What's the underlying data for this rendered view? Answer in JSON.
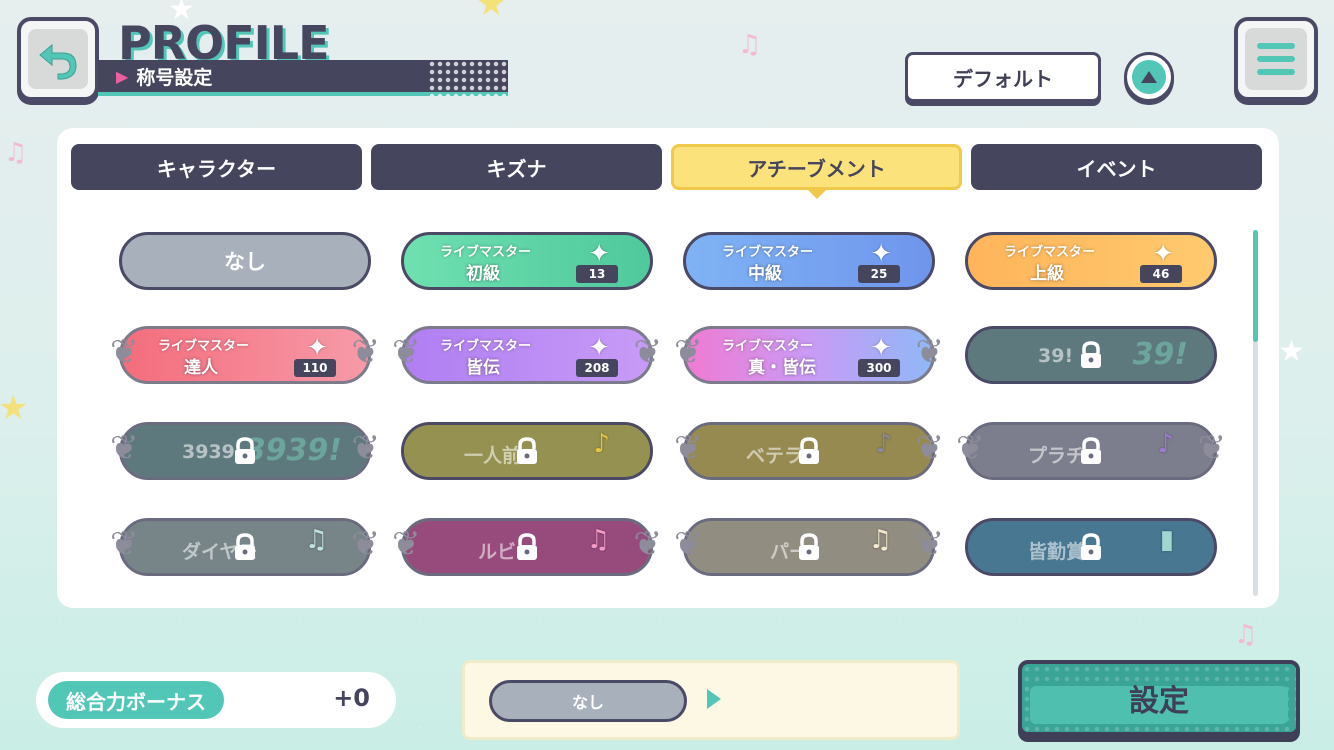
{
  "header": {
    "title": "PROFILE",
    "subtitle": "称号設定",
    "sort_label": "デフォルト"
  },
  "tabs": [
    {
      "label": "キャラクター",
      "active": false
    },
    {
      "label": "キズナ",
      "active": false
    },
    {
      "label": "アチーブメント",
      "active": true
    },
    {
      "label": "イベント",
      "active": false
    }
  ],
  "titles": {
    "none": "なし",
    "r1c2": {
      "line1": "ライブマスター",
      "line2": "初級",
      "number": "13"
    },
    "r1c3": {
      "line1": "ライブマスター",
      "line2": "中級",
      "number": "25"
    },
    "r1c4": {
      "line1": "ライブマスター",
      "line2": "上級",
      "number": "46"
    },
    "r2c1": {
      "line1": "ライブマスター",
      "line2": "達人",
      "number": "110"
    },
    "r2c2": {
      "line1": "ライブマスター",
      "line2": "皆伝",
      "number": "208"
    },
    "r2c3": {
      "line1": "ライブマスター",
      "line2": "真・皆伝",
      "number": "300"
    },
    "r2c4": {
      "text": "39!",
      "big": "39!"
    },
    "r3c1": {
      "text": "3939",
      "big": "3939!"
    },
    "r3c2": {
      "text": "一人前"
    },
    "r3c3": {
      "text": "ベテラ"
    },
    "r3c4": {
      "text": "プラチ"
    },
    "r4c1": {
      "text": "ダイヤモ"
    },
    "r4c2": {
      "text": "ルビ"
    },
    "r4c3": {
      "text": "パー"
    },
    "r4c4": {
      "text": "皆勤賞"
    }
  },
  "footer": {
    "bonus_label": "総合力ボーナス",
    "bonus_value": "+0",
    "preview_label": "なし",
    "set_button": "設定"
  },
  "colors": {
    "accent": "#52c7b8",
    "dark": "#45455d",
    "tab_active": "#fbe27b",
    "pink": "#ef5f9f"
  },
  "icons": [
    "back-arrow-icon",
    "menu-icon",
    "sort-up-icon",
    "lock-icon",
    "play-arrow-icon"
  ]
}
